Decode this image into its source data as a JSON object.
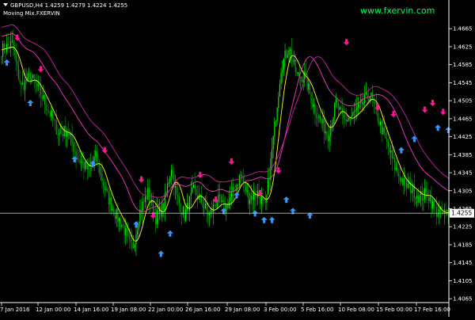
{
  "header": {
    "symbol_line": "GBPUSD,H4  1.4259 1.4279 1.4224 1.4255",
    "indicator": "Moving Mix.FXERVIN"
  },
  "watermark": "www.fxervin.com",
  "colors": {
    "background": "#000000",
    "bull": "#00ff00",
    "bear": "#00aa00",
    "ma_fast": "#ffff00",
    "ma_slow_1": "#ff33cc",
    "ma_slow_2": "#cc22aa",
    "arrow_up": "#3399ff",
    "arrow_down": "#ff1493",
    "axis_text": "#ffffff",
    "watermark": "#00ff66",
    "price_label_bg": "#ffffff"
  },
  "price_axis": {
    "ticks": [
      "1.4665",
      "1.4625",
      "1.4585",
      "1.4545",
      "1.4505",
      "1.4465",
      "1.4425",
      "1.4385",
      "1.4345",
      "1.4305",
      "1.4265",
      "1.4225",
      "1.4185",
      "1.4145",
      "1.4105",
      "1.4065"
    ],
    "current_price": "1.4255"
  },
  "time_axis": {
    "ticks": [
      "7 Jan 2016",
      "12 Jan 00:00",
      "14 Jan 16:00",
      "19 Jan 08:00",
      "22 Jan 00:00",
      "26 Jan 16:00",
      "29 Jan 08:00",
      "3 Feb 00:00",
      "5 Feb 16:00",
      "10 Feb 08:00",
      "15 Feb 00:00",
      "17 Feb 16:00"
    ]
  },
  "chart_data": {
    "type": "candlestick",
    "symbol": "GBPUSD",
    "timeframe": "H4",
    "last_bar": {
      "open": 1.4259,
      "high": 1.4279,
      "low": 1.4224,
      "close": 1.4255
    },
    "ylim": [
      1.406,
      1.469
    ],
    "current_price": 1.4255,
    "close_path": [
      [
        0,
        1.4618
      ],
      [
        8,
        1.463
      ],
      [
        15,
        1.4535
      ],
      [
        22,
        1.456
      ],
      [
        30,
        1.452
      ],
      [
        38,
        1.447
      ],
      [
        44,
        1.443
      ],
      [
        50,
        1.444
      ],
      [
        58,
        1.438
      ],
      [
        66,
        1.435
      ],
      [
        72,
        1.438
      ],
      [
        80,
        1.43
      ],
      [
        86,
        1.426
      ],
      [
        93,
        1.4225
      ],
      [
        100,
        1.417
      ],
      [
        106,
        1.426
      ],
      [
        112,
        1.43
      ],
      [
        118,
        1.4245
      ],
      [
        124,
        1.427
      ],
      [
        130,
        1.436
      ],
      [
        134,
        1.429
      ],
      [
        140,
        1.425
      ],
      [
        147,
        1.4305
      ],
      [
        153,
        1.428
      ],
      [
        159,
        1.425
      ],
      [
        165,
        1.4285
      ],
      [
        171,
        1.4265
      ],
      [
        177,
        1.43
      ],
      [
        183,
        1.434
      ],
      [
        189,
        1.429
      ],
      [
        196,
        1.43
      ],
      [
        202,
        1.4265
      ],
      [
        208,
        1.442
      ],
      [
        214,
        1.458
      ],
      [
        220,
        1.4625
      ],
      [
        226,
        1.456
      ],
      [
        232,
        1.456
      ],
      [
        238,
        1.45
      ],
      [
        244,
        1.446
      ],
      [
        250,
        1.443
      ],
      [
        256,
        1.45
      ],
      [
        262,
        1.446
      ],
      [
        268,
        1.447
      ],
      [
        274,
        1.449
      ],
      [
        282,
        1.452
      ],
      [
        290,
        1.445
      ],
      [
        296,
        1.44
      ],
      [
        302,
        1.435
      ],
      [
        308,
        1.432
      ],
      [
        314,
        1.431
      ],
      [
        320,
        1.429
      ],
      [
        326,
        1.43
      ],
      [
        332,
        1.426
      ],
      [
        338,
        1.4255
      ],
      [
        342,
        1.4255
      ]
    ],
    "moving_averages": [
      {
        "role": "fast",
        "color": "#ffff00",
        "offset": 0.0,
        "smooth": 2
      },
      {
        "role": "slow-1",
        "color": "#ff33cc",
        "offset": 0.003,
        "smooth": 6
      },
      {
        "role": "slow-2",
        "color": "#cc22aa",
        "offset": 0.005,
        "smooth": 8
      }
    ],
    "signals": [
      {
        "bar": 4,
        "dir": "up",
        "price": 1.459
      },
      {
        "bar": 12,
        "dir": "down",
        "price": 1.4645
      },
      {
        "bar": 22,
        "dir": "up",
        "price": 1.45
      },
      {
        "bar": 30,
        "dir": "down",
        "price": 1.4575
      },
      {
        "bar": 56,
        "dir": "up",
        "price": 1.4375
      },
      {
        "bar": 70,
        "dir": "up",
        "price": 1.4365
      },
      {
        "bar": 79,
        "dir": "down",
        "price": 1.4395
      },
      {
        "bar": 107,
        "dir": "down",
        "price": 1.433
      },
      {
        "bar": 103,
        "dir": "up",
        "price": 1.423
      },
      {
        "bar": 116,
        "dir": "down",
        "price": 1.425
      },
      {
        "bar": 122,
        "dir": "up",
        "price": 1.4165
      },
      {
        "bar": 129,
        "dir": "up",
        "price": 1.421
      },
      {
        "bar": 152,
        "dir": "down",
        "price": 1.434
      },
      {
        "bar": 164,
        "dir": "down",
        "price": 1.4285
      },
      {
        "bar": 170,
        "dir": "up",
        "price": 1.426
      },
      {
        "bar": 176,
        "dir": "down",
        "price": 1.437
      },
      {
        "bar": 180,
        "dir": "up",
        "price": 1.4295
      },
      {
        "bar": 194,
        "dir": "up",
        "price": 1.4255
      },
      {
        "bar": 198,
        "dir": "down",
        "price": 1.43
      },
      {
        "bar": 201,
        "dir": "up",
        "price": 1.424
      },
      {
        "bar": 207,
        "dir": "up",
        "price": 1.424
      },
      {
        "bar": 212,
        "dir": "down",
        "price": 1.435
      },
      {
        "bar": 218,
        "dir": "up",
        "price": 1.4285
      },
      {
        "bar": 223,
        "dir": "up",
        "price": 1.426
      },
      {
        "bar": 236,
        "dir": "up",
        "price": 1.425
      },
      {
        "bar": 264,
        "dir": "down",
        "price": 1.4635
      },
      {
        "bar": 288,
        "dir": "down",
        "price": 1.449
      },
      {
        "bar": 300,
        "dir": "down",
        "price": 1.4475
      },
      {
        "bar": 306,
        "dir": "up",
        "price": 1.4395
      },
      {
        "bar": 316,
        "dir": "up",
        "price": 1.442
      },
      {
        "bar": 324,
        "dir": "down",
        "price": 1.4485
      },
      {
        "bar": 330,
        "dir": "down",
        "price": 1.45
      },
      {
        "bar": 334,
        "dir": "up",
        "price": 1.4445
      },
      {
        "bar": 338,
        "dir": "down",
        "price": 1.448
      },
      {
        "bar": 342,
        "dir": "up",
        "price": 1.444
      }
    ]
  }
}
